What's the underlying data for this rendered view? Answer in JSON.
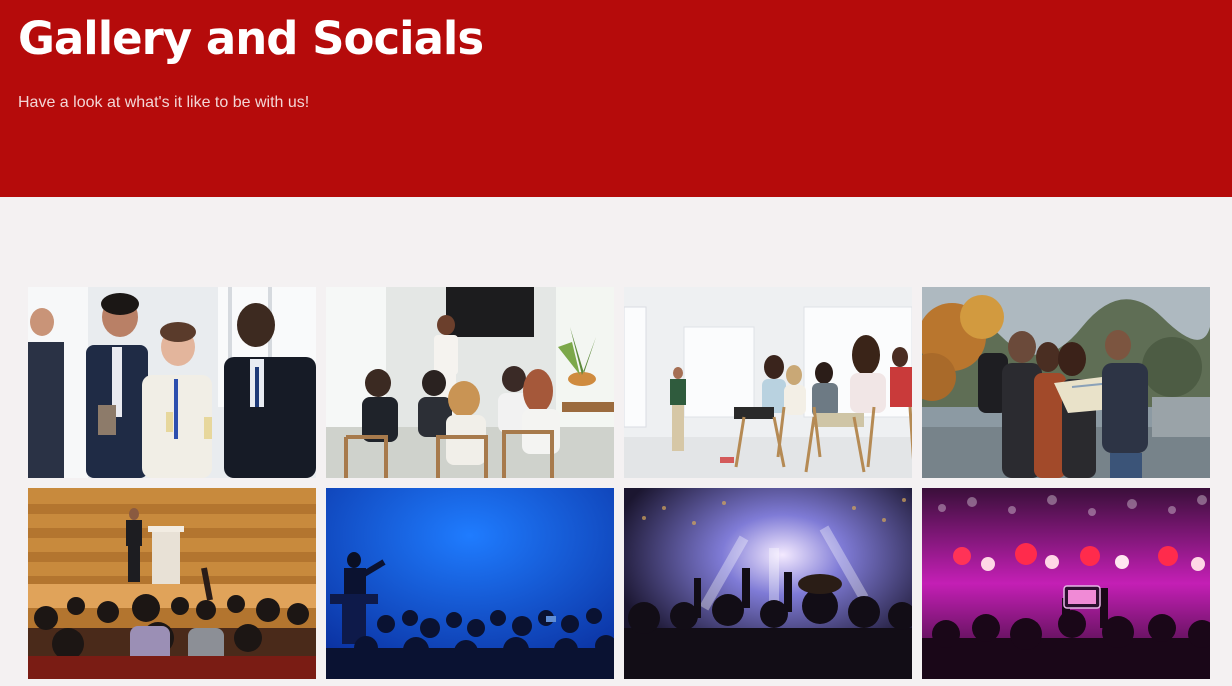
{
  "header": {
    "title": "Gallery and Socials",
    "subtitle": "Have a look at what's it like to be with us!"
  },
  "colors": {
    "brand_red": "#b50b0b",
    "page_background": "#f4f1f2"
  },
  "gallery": {
    "photos": [
      {
        "subject": "business-networking-photo"
      },
      {
        "subject": "workshop-presentation-photo"
      },
      {
        "subject": "seminar-audience-photo"
      },
      {
        "subject": "friends-with-map-photo"
      },
      {
        "subject": "auditorium-speaker-photo"
      },
      {
        "subject": "blue-stage-speaker-photo"
      },
      {
        "subject": "concert-crowd-photo"
      },
      {
        "subject": "pink-concert-lights-photo"
      }
    ]
  }
}
